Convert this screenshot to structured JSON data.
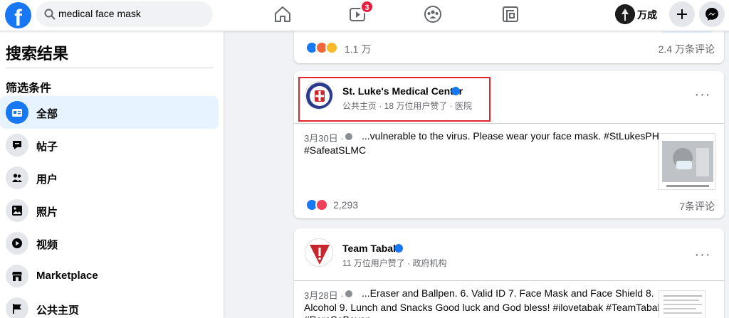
{
  "topbar": {
    "logo": "f",
    "search_value": "medical face mask",
    "watch_badge": "3",
    "profile_name": "万成",
    "icons": [
      "facebook-logo",
      "search-icon",
      "home-icon",
      "watch-icon",
      "groups-icon",
      "gaming-icon",
      "plus-icon",
      "messenger-icon"
    ]
  },
  "sidebar": {
    "title": "搜索结果",
    "filter_label": "筛选条件",
    "items": [
      {
        "label": "全部",
        "icon": "all-icon",
        "active": true
      },
      {
        "label": "帖子",
        "icon": "posts-icon"
      },
      {
        "label": "用户",
        "icon": "people-icon"
      },
      {
        "label": "照片",
        "icon": "photos-icon"
      },
      {
        "label": "视频",
        "icon": "video-icon"
      },
      {
        "label": "Marketplace",
        "icon": "marketplace-icon"
      },
      {
        "label": "公共主页",
        "icon": "flag-icon"
      }
    ]
  },
  "results": {
    "top_card": {
      "reaction_count": "1.1 万",
      "comments": "2.4 万条评论"
    },
    "post1": {
      "page_name": "St. Luke's Medical Center",
      "meta": "公共主页 · 18 万位用户赞了 · 医院",
      "date": "3月30日 ·",
      "text_line1": "...vulnerable to the virus. Please wear your face mask. #StLukesPH",
      "text_line2": "#SafeatSLMC",
      "reaction_count": "2,293",
      "comments": "7条评论"
    },
    "post2": {
      "page_name": "Team Tabak",
      "meta": "11 万位用户赞了 · 政府机构",
      "date": "3月28日 ·",
      "text_line1": "...Eraser and Ballpen. 6. Valid ID 7. Face Mask and Face Shield 8.",
      "text_line2": "Alcohol 9. Lunch and Snacks Good luck and God bless! #ilovetabak #TeamTabak",
      "text_line3": "#ParaSaBayan"
    }
  },
  "colors": {
    "brand": "#1877f2",
    "highlight": "#e3262b",
    "badge": "#e41e3f"
  }
}
